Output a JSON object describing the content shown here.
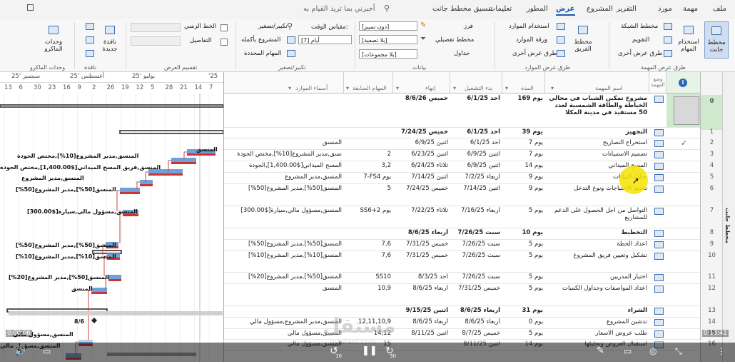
{
  "menu": {
    "tabs": [
      "ملف",
      "مهمة",
      "مورد",
      "التقرير",
      "المشروع",
      "عرض",
      "المطور",
      "تعليمات",
      "تنسيق مخطط جانت"
    ],
    "active": "عرض",
    "search_placeholder": "أخبرني بما تريد القيام به"
  },
  "ribbon": {
    "gantt_chart": "مخطط جانت",
    "task_usage": "استخدام المهام",
    "network_diagram": "مخطط الشبكة",
    "calendar": "التقويم",
    "other_views": "طرق عرض أخرى",
    "group_task_views": "طرق عرض المهمة",
    "team_planner": "مخطط الفريق",
    "resource_usage": "استخدام الموارد",
    "resource_sheet": "ورقة الموارد",
    "other_views2": "طرق عرض أخرى",
    "group_resource_views": "طرق عرض الموارد",
    "sort": "فرز",
    "outline": "مخطط تفصيلي",
    "tables": "جداول",
    "highlight_value": "[دون تمييز]",
    "filter_value": "[بلا تصفية]",
    "group_value": "[بلا مجموعات]",
    "group_data": "بيانات",
    "zoom": "تكبير/تصغير",
    "timescale_label": "مقياس الوقت:",
    "timescale_value": "[7] أيام",
    "entire_project": "المشروع بأكمله",
    "selected_tasks": "المهام المحددة",
    "group_zoom": "تكبير/تصغير",
    "timeline": "الخط الزمني",
    "details": "التفاصيل",
    "group_split": "تقسيم العرض",
    "new_window": "نافذة جديدة",
    "group_window": "نافذة",
    "macros": "وحدات الماكرو",
    "group_macros": "وحدات الماكرو"
  },
  "timescale": {
    "months": [
      "سبتمبر '25",
      "أغسطس '25",
      "يوليو '25",
      "'25"
    ],
    "days": [
      "13",
      "6",
      "30",
      "23",
      "16",
      "9",
      "2",
      "26",
      "19",
      "12",
      "5",
      "28",
      "21",
      "14",
      "7"
    ]
  },
  "grid": {
    "headers": {
      "info": "i",
      "mode": "وضع المهمة",
      "name": "اسم المهمة",
      "duration": "المدة",
      "start": "بدء التشغيل",
      "finish": "إنهاء",
      "predecessors": "المهام السابقة",
      "resources": "أسماء الموارد"
    },
    "rows": [
      {
        "id": "0",
        "name": "مشروع تمكين الشباب في مجالي الخياطة والطاقة الشمسية لعدد 50 مستفيد في مدينة المكلا",
        "duration": "169 يوم",
        "start": "أحد 6/1/25",
        "finish": "خميس 8/6/26",
        "pred": "",
        "res": "",
        "summary": true,
        "check": false
      },
      {
        "id": "1",
        "name": "التجهيز",
        "duration": "39 يوم",
        "start": "أحد 6/1/25",
        "finish": "خميس 7/24/25",
        "pred": "",
        "res": "",
        "summary": true,
        "check": false
      },
      {
        "id": "2",
        "name": "استخراج التصاريح",
        "duration": "7 يوم",
        "start": "أحد 6/1/25",
        "finish": "اثنين 6/9/25",
        "pred": "",
        "res": "المنسق",
        "summary": false,
        "check": true
      },
      {
        "id": "3",
        "name": "تصميم الاستبيانات",
        "duration": "7 يوم",
        "start": "اثنين 6/9/25",
        "finish": "اثنين 6/23/25",
        "pred": "2",
        "res": "نسق,مدير المشروع[10%],مختص الجودة",
        "summary": false,
        "check": false
      },
      {
        "id": "4",
        "name": "المسح الميداني",
        "duration": "14 يوم",
        "start": "اثنين 6/9/25",
        "finish": "ثلاثاء 6/24/25",
        "pred": "3,2",
        "res": "المسح الميداني[$1,400.00],الجودة",
        "summary": false,
        "check": false
      },
      {
        "id": "5",
        "name": "تحليل البيانات",
        "duration": "9 يوم",
        "start": "أربعاء 7/2/25",
        "finish": "اثنين 7/14/25",
        "pred": "7-FS4 يوم",
        "res": "المنسق,مدير المشروع",
        "summary": false,
        "check": false
      },
      {
        "id": "6",
        "name": "تحديد الاحتياجات ونوع التدخل",
        "duration": "9 يوم",
        "start": "اثنين 7/14/25",
        "finish": "خميس 7/24/25",
        "pred": "5",
        "res": "المنسق[50%],مدير المشروع[50%]",
        "summary": false,
        "check": false
      },
      {
        "id": "7",
        "name": "التواصل من اجل الحصول على الدعم للمشاريع",
        "duration": "5 يوم",
        "start": "أربعاء 7/16/25",
        "finish": "ثلاثاء 7/22/25",
        "pred": "SS6+2 يوم",
        "res": "المنسق,مسؤول مالي,سيارة[$300.00]",
        "summary": false,
        "check": false
      },
      {
        "id": "8",
        "name": "التخطيط",
        "duration": "10 يوم",
        "start": "سبت 7/26/25",
        "finish": "أربعاء 8/6/25",
        "pred": "",
        "res": "",
        "summary": true,
        "check": false
      },
      {
        "id": "9",
        "name": "اعداد الخطة",
        "duration": "5 يوم",
        "start": "سبت 7/26/25",
        "finish": "خميس 7/31/25",
        "pred": "7,6",
        "res": "المنسق[50%],مدير المشروع[50%]",
        "summary": false,
        "check": false
      },
      {
        "id": "10",
        "name": "تشكيل وتعيين فريق المشروع",
        "duration": "5 يوم",
        "start": "سبت 7/26/25",
        "finish": "خميس 7/31/25",
        "pred": "7,6",
        "res": "المنسق[10%],مدير المشروع[10%]",
        "summary": false,
        "check": false
      },
      {
        "id": "11",
        "name": "اختيار المدربين",
        "duration": "5 يوم",
        "start": "سبت 7/26/25",
        "finish": "أحد 8/3/25",
        "pred": "SS10",
        "res": "المنسق[50%],مدير المشروع[20%]",
        "summary": false,
        "check": false
      },
      {
        "id": "12",
        "name": "اعداد المواصفات وجداول الكميات",
        "duration": "5 يوم",
        "start": "خميس 7/31/25",
        "finish": "أربعاء 8/6/25",
        "pred": "10,9",
        "res": "المنسق",
        "summary": false,
        "check": false
      },
      {
        "id": "13",
        "name": "الشراء",
        "duration": "31 يوم",
        "start": "أربعاء 8/6/25",
        "finish": "اثنين 9/15/25",
        "pred": "",
        "res": "",
        "summary": true,
        "check": false
      },
      {
        "id": "14",
        "name": "تدشين المشروع",
        "duration": "0 يوم",
        "start": "أربعاء 8/6/25",
        "finish": "أربعاء 8/6/25",
        "pred": "12,11,10,9",
        "res": "المنسق,مدير المشروع,مسؤول مالي",
        "summary": false,
        "check": false
      },
      {
        "id": "15",
        "name": "طلب عروض الأسعار",
        "duration": "5 يوم",
        "start": "خميس 8/7/25",
        "finish": "اثنين 8/11/25",
        "pred": "14,12",
        "res": "المنسق,مسؤول مالي",
        "summary": false,
        "check": false
      },
      {
        "id": "16",
        "name": "استقبال العروض وتحليلها",
        "duration": "14 يوم",
        "start": "اثنين 8/11/25",
        "finish": "",
        "pred": "15",
        "res": "المنسق,مسؤول مالي",
        "summary": false,
        "check": false
      }
    ]
  },
  "gantt_labels": [
    {
      "row": "2",
      "text": "المنسق"
    },
    {
      "row": "3",
      "text": "المنسق,مدير المشروع[10%],مختص الجودة"
    },
    {
      "row": "4",
      "text": "المنسق,فريق المسح الميداني[$1,400.00],مختص الجودة"
    },
    {
      "row": "5",
      "text": "المنسق,مدير المشروع"
    },
    {
      "row": "6",
      "text": "المنسق[50%],مدير المشروع[50%]"
    },
    {
      "row": "7",
      "text": "المنسق,مسؤول مالي,سيارة[$300.00]"
    },
    {
      "row": "9",
      "text": "المنسق[50%],مدير المشروع[50%]"
    },
    {
      "row": "10",
      "text": "المنسق[10%],مدير المشروع[10%]"
    },
    {
      "row": "11",
      "text": "المنسق[50%],مدير المشروع[20%]"
    },
    {
      "row": "12",
      "text": "المنسق"
    },
    {
      "row": "14",
      "text": "8/6"
    },
    {
      "row": "15",
      "text": "المنسق,مسؤول مالي"
    },
    {
      "row": "16",
      "text": "المنسق,مسؤول مالي"
    }
  ],
  "side_label": "مخطط جانت",
  "video": {
    "elapsed": "0:00:06",
    "remaining": "0:13:41",
    "watermark": "مستقل",
    "watermark_sub": "mostaql.com",
    "skip_back": "10",
    "skip_fwd": "30"
  },
  "colors": {
    "accent": "#1e5aa8",
    "task_bar": "#cc3333",
    "summary_bar": "#222222",
    "row0_fill": "#cfe9cf",
    "highlight": "#f5e400"
  }
}
